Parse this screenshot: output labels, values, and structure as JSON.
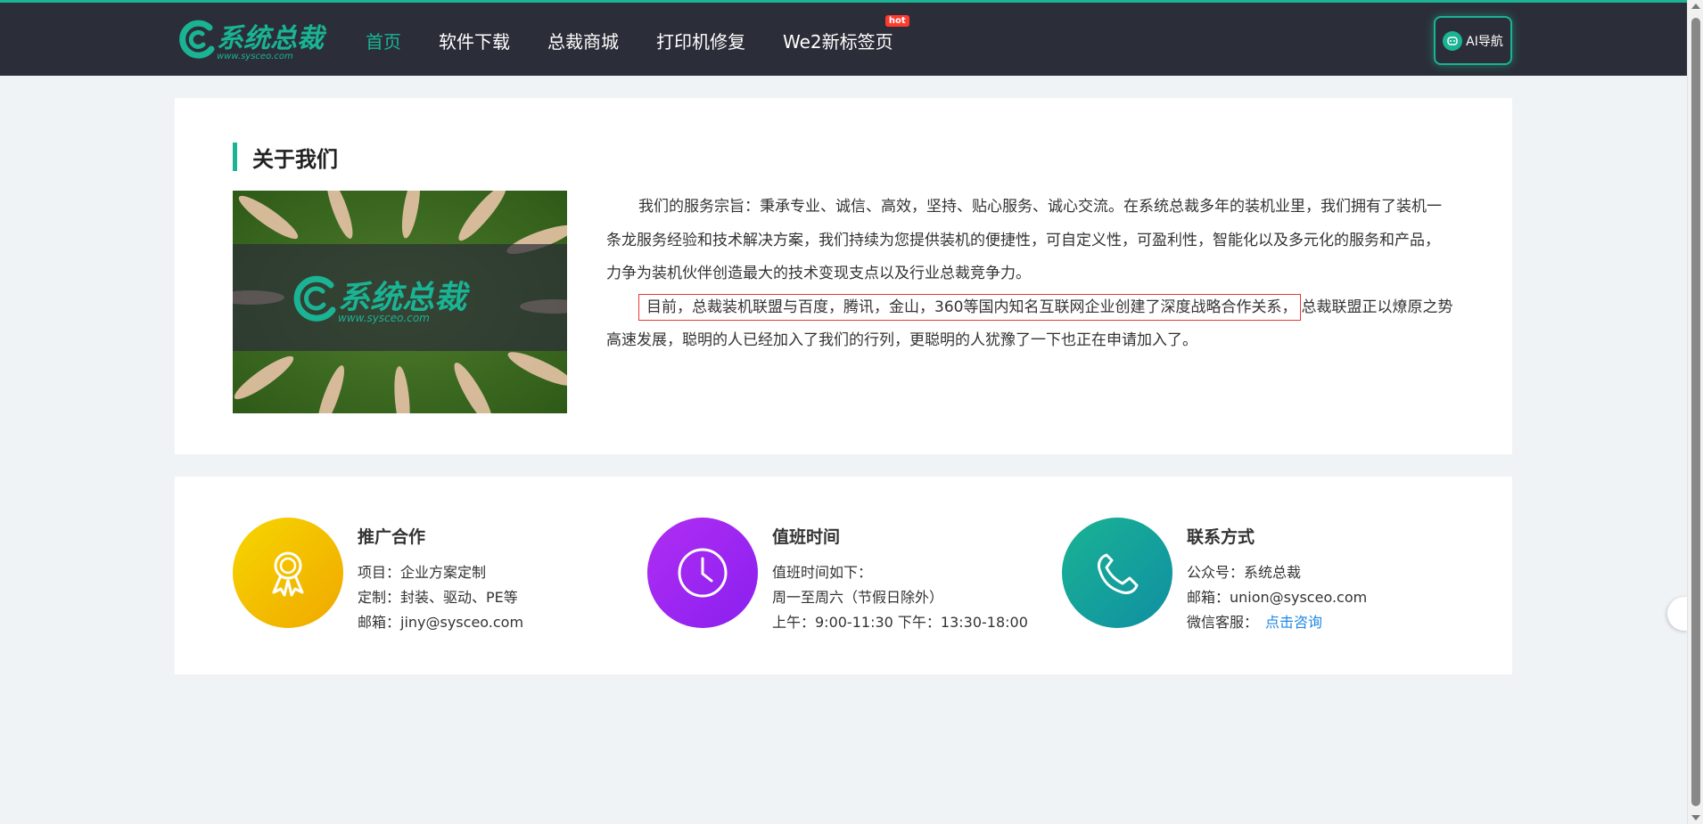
{
  "header": {
    "logo": {
      "text": "系统总裁",
      "url_text": "www.sysceo.com"
    },
    "nav": [
      {
        "label": "首页"
      },
      {
        "label": "软件下载"
      },
      {
        "label": "总裁商城"
      },
      {
        "label": "打印机修复"
      },
      {
        "label": "We2新标签页",
        "badge": "hot"
      }
    ],
    "ai_button": {
      "label": "AI导航"
    },
    "accent_color": "#1ab394"
  },
  "about": {
    "title": "关于我们",
    "image": {
      "logo_text": "系统总裁",
      "url_text": "www.sysceo.com"
    },
    "paragraph1": "我们的服务宗旨：秉承专业、诚信、高效，坚持、贴心服务、诚心交流。在系统总裁多年的装机业里，我们拥有了装机一条龙服务经验和技术解决方案，我们持续为您提供装机的便捷性，可自定义性，可盈利性，智能化以及多元化的服务和产品，力争为装机伙伴创造最大的技术变现支点以及行业总裁竞争力。",
    "paragraph2_highlight": "目前，总裁装机联盟与百度，腾讯，金山，360等国内知名互联网企业创建了深度战略合作关系，",
    "paragraph2_rest": "总裁联盟正以燎原之势高速发展，聪明的人已经加入了我们的行列，更聪明的人犹豫了一下也正在申请加入了。"
  },
  "contact": {
    "cooperation": {
      "icon": "award-icon",
      "color": "#f5c200",
      "title": "推广合作",
      "lines": [
        "项目：企业方案定制",
        "定制：封装、驱动、PE等",
        "邮箱：jiny@sysceo.com"
      ]
    },
    "hours": {
      "icon": "clock-icon",
      "color": "#9b27f0",
      "title": "值班时间",
      "lines": [
        "值班时间如下：",
        "周一至周六（节假日除外）",
        "上午：9:00-11:30 下午：13:30-18:00"
      ]
    },
    "contact": {
      "icon": "phone-icon",
      "color": "#139d96",
      "title": "联系方式",
      "lines": [
        "公众号：系统总裁",
        "邮箱：union@sysceo.com"
      ],
      "wechat_label": "微信客服：",
      "wechat_link": "点击咨询"
    }
  }
}
